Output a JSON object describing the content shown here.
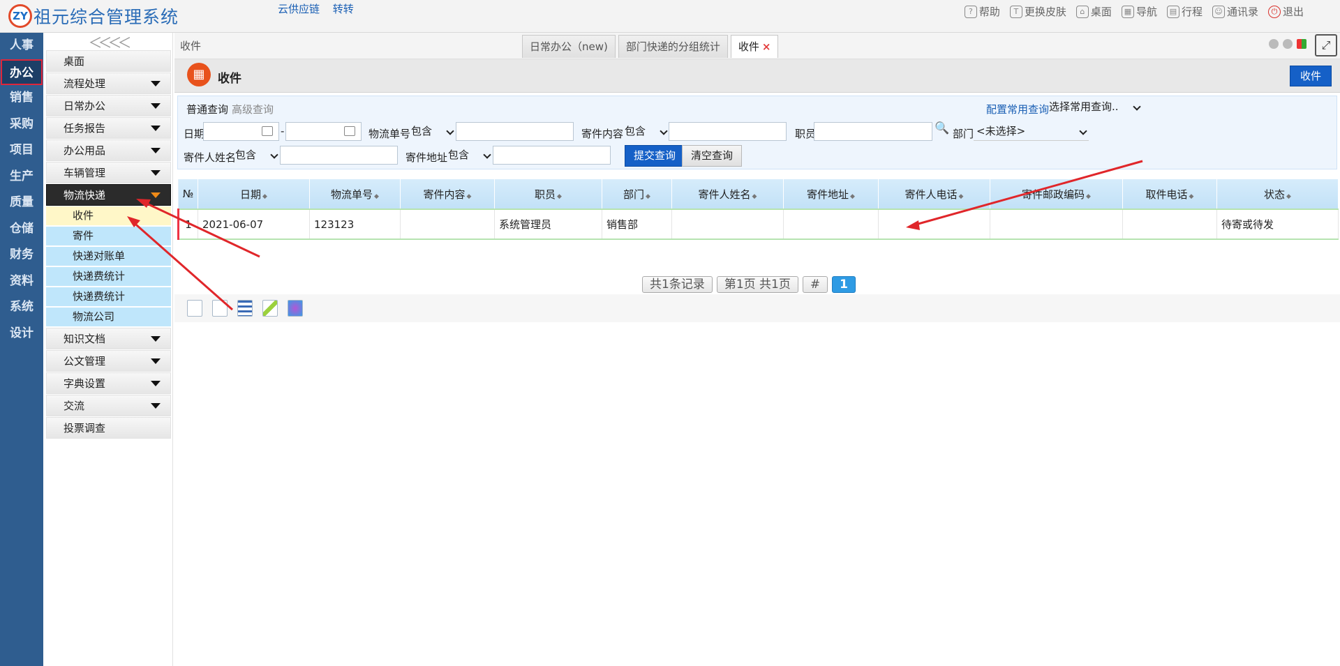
{
  "app": {
    "logo_mark": "ZY",
    "title": "祖元综合管理系统"
  },
  "top_links": [
    "云供应链",
    "转转"
  ],
  "top_right": [
    {
      "label": "帮助",
      "icon": "help-icon"
    },
    {
      "label": "更换皮肤",
      "icon": "shirt-icon"
    },
    {
      "label": "桌面",
      "icon": "home-icon"
    },
    {
      "label": "导航",
      "icon": "grid-icon"
    },
    {
      "label": "行程",
      "icon": "calendar-icon"
    },
    {
      "label": "通讯录",
      "icon": "contacts-icon"
    },
    {
      "label": "退出",
      "icon": "power-icon"
    }
  ],
  "left_nav": [
    "人事",
    "办公",
    "销售",
    "采购",
    "项目",
    "生产",
    "质量",
    "仓储",
    "财务",
    "资料",
    "系统",
    "设计"
  ],
  "left_nav_active": "办公",
  "sidebar": {
    "menu": [
      {
        "label": "桌面"
      },
      {
        "label": "流程处理"
      },
      {
        "label": "日常办公"
      },
      {
        "label": "任务报告"
      },
      {
        "label": "办公用品"
      },
      {
        "label": "车辆管理"
      },
      {
        "label": "物流快递"
      },
      {
        "label": "知识文档"
      },
      {
        "label": "公文管理"
      },
      {
        "label": "字典设置"
      },
      {
        "label": "交流"
      },
      {
        "label": "投票调查"
      }
    ],
    "logistics_sub": [
      "收件",
      "寄件",
      "快递对账单",
      "快递费统计",
      "快递费统计",
      "物流公司"
    ]
  },
  "tabbar": {
    "crumb": "收件",
    "tabs": [
      {
        "label": "日常办公（new)"
      },
      {
        "label": "部门快递的分组统计"
      },
      {
        "label": "收件",
        "close": "×"
      }
    ]
  },
  "page": {
    "title": "收件",
    "action_button": "收件"
  },
  "query": {
    "tab_normal": "普通查询",
    "tab_advanced": "高级查询",
    "config_link": "配置常用查询",
    "common_select": "选择常用查询..",
    "date_label": "日期",
    "date_sep": "-",
    "tracking_label": "物流单号",
    "tracking_op": "包含",
    "content_label": "寄件内容",
    "content_op": "包含",
    "staff_label": "职员",
    "dept_label": "部门",
    "dept_value": "<未选择>",
    "sender_name_label": "寄件人姓名",
    "sender_name_op": "包含",
    "sender_addr_label": "寄件地址",
    "sender_addr_op": "包含",
    "submit": "提交查询",
    "clear": "清空查询"
  },
  "table": {
    "columns": [
      "№",
      "日期",
      "物流单号",
      "寄件内容",
      "职员",
      "部门",
      "寄件人姓名",
      "寄件地址",
      "寄件人电话",
      "寄件邮政编码",
      "取件电话",
      "状态"
    ],
    "rows": [
      [
        "1",
        "2021-06-07",
        "123123",
        "",
        "系统管理员",
        "销售部",
        "",
        "",
        "",
        "",
        "",
        "待寄或待发"
      ]
    ]
  },
  "pager": {
    "total": "共1条记录",
    "page_info": "第1页 共1页",
    "hash": "#",
    "current": "1"
  },
  "colors": {
    "nav_bg": "#2f5d8f",
    "primary": "#1560c7",
    "arrow": "#e0262a",
    "submenu": "#bfe6fb",
    "highlight": "#fff7c8"
  }
}
